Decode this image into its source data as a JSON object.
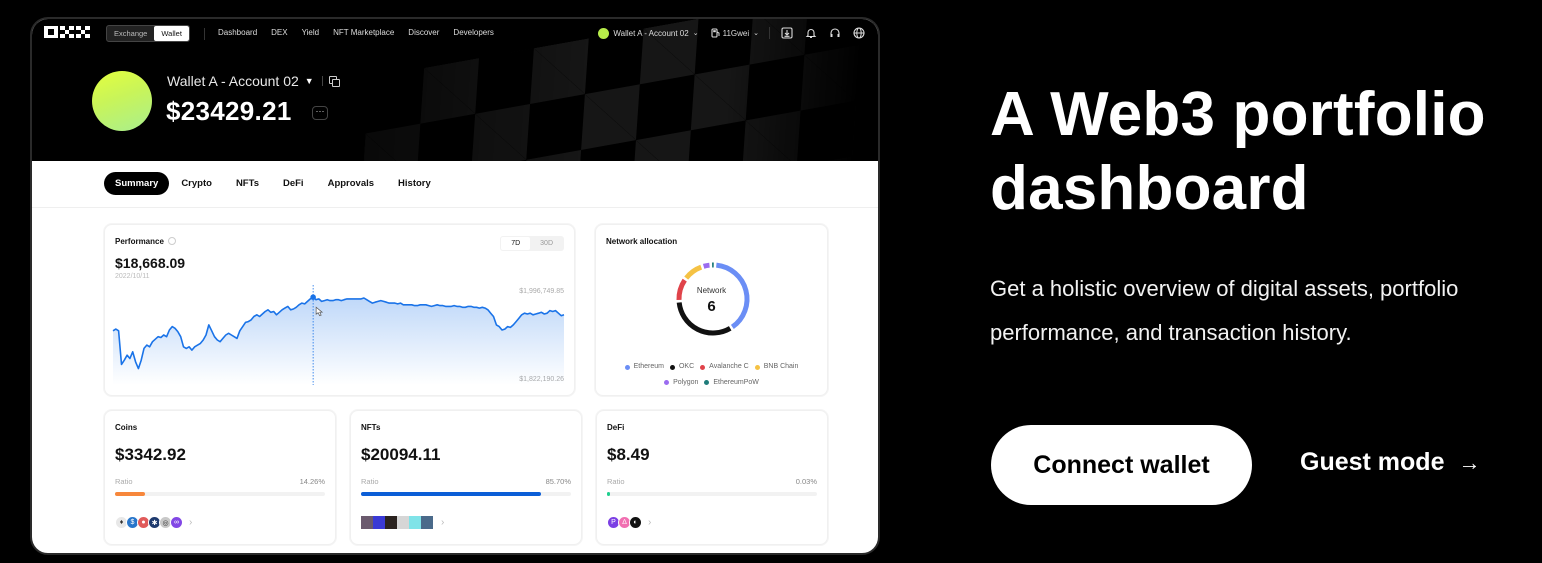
{
  "app": {
    "logo": "OKX",
    "mode_toggle": [
      {
        "label": "Exchange",
        "active": false
      },
      {
        "label": "Wallet",
        "active": true
      }
    ],
    "nav": [
      "Dashboard",
      "DEX",
      "Yield",
      "NFT Marketplace",
      "Discover",
      "Developers"
    ],
    "account_selector": "Wallet A - Account 02",
    "gas": "11Gwei",
    "toolbar_icons": [
      "download-icon",
      "bell-icon",
      "headset-icon",
      "globe-icon"
    ]
  },
  "account": {
    "name": "Wallet A - Account 02",
    "balance": "$23429.21",
    "more_label": "···"
  },
  "tabs": [
    {
      "label": "Summary",
      "active": true
    },
    {
      "label": "Crypto",
      "active": false
    },
    {
      "label": "NFTs",
      "active": false
    },
    {
      "label": "DeFi",
      "active": false
    },
    {
      "label": "Approvals",
      "active": false
    },
    {
      "label": "History",
      "active": false
    }
  ],
  "performance": {
    "title": "Performance",
    "value": "$18,668.09",
    "date": "2022/10/11",
    "ranges": [
      {
        "label": "7D",
        "active": true
      },
      {
        "label": "30D",
        "active": false
      }
    ],
    "y_max_label": "$1,996,749.85",
    "y_min_label": "$1,822,190.26",
    "line_color": "#1a73e8"
  },
  "network_allocation": {
    "title": "Network allocation",
    "center_label": "Network",
    "center_value": "6",
    "segments": [
      {
        "name": "Ethereum",
        "color": "#6b8ef5",
        "share": 0.4
      },
      {
        "name": "OKC",
        "color": "#111111",
        "share": 0.33
      },
      {
        "name": "Avalanche C",
        "color": "#e0434a",
        "share": 0.11
      },
      {
        "name": "BNB Chain",
        "color": "#f5c244",
        "share": 0.1
      },
      {
        "name": "Polygon",
        "color": "#9b6cf0",
        "share": 0.04
      },
      {
        "name": "EthereumPoW",
        "color": "#1f7c7a",
        "share": 0.02
      }
    ]
  },
  "summaries": [
    {
      "title": "Coins",
      "amount": "$3342.92",
      "ratio_label": "Ratio",
      "ratio_text": "14.26%",
      "ratio": 0.1426,
      "bar_color": "#f7873b",
      "icons": [
        {
          "name": "ethereum-icon",
          "color": "#e8e8e8",
          "glyph": "♦"
        },
        {
          "name": "usdc-icon",
          "color": "#2775ca",
          "glyph": "$"
        },
        {
          "name": "token-red-icon",
          "color": "#e05a5a",
          "glyph": "●"
        },
        {
          "name": "token-navy-icon",
          "color": "#1e3a6e",
          "glyph": "✱"
        },
        {
          "name": "token-grey-icon",
          "color": "#c8c8c8",
          "glyph": "◎"
        },
        {
          "name": "polygon-icon",
          "color": "#8247e5",
          "glyph": "∞"
        }
      ]
    },
    {
      "title": "NFTs",
      "amount": "$20094.11",
      "ratio_label": "Ratio",
      "ratio_text": "85.70%",
      "ratio": 0.857,
      "bar_color": "#0b5ed7",
      "icons": [
        {
          "name": "nft-thumb-1",
          "color": "#6b5a6e",
          "glyph": ""
        },
        {
          "name": "nft-thumb-2",
          "color": "#3a3ad6",
          "glyph": ""
        },
        {
          "name": "nft-thumb-3",
          "color": "#2b2320",
          "glyph": ""
        },
        {
          "name": "nft-thumb-4",
          "color": "#d6d6d6",
          "glyph": ""
        },
        {
          "name": "nft-thumb-5",
          "color": "#7fe3e8",
          "glyph": ""
        },
        {
          "name": "nft-thumb-6",
          "color": "#4a6a8a",
          "glyph": ""
        }
      ]
    },
    {
      "title": "DeFi",
      "amount": "$8.49",
      "ratio_label": "Ratio",
      "ratio_text": "0.03%",
      "ratio": 0.0003,
      "bar_color": "#1fcf8f",
      "icons": [
        {
          "name": "defi-protocol-p-icon",
          "color": "#7b3fe4",
          "glyph": "P"
        },
        {
          "name": "defi-protocol-pink-icon",
          "color": "#f16fb1",
          "glyph": "∆"
        },
        {
          "name": "defi-protocol-dark-icon",
          "color": "#111111",
          "glyph": "◐"
        }
      ]
    }
  ],
  "marketing": {
    "headline_line1": "A Web3 portfolio",
    "headline_line2": "dashboard",
    "subline": "Get a holistic overview of digital assets, portfolio performance, and transaction history.",
    "primary_cta": "Connect wallet",
    "secondary_cta": "Guest mode",
    "secondary_arrow": "→"
  }
}
